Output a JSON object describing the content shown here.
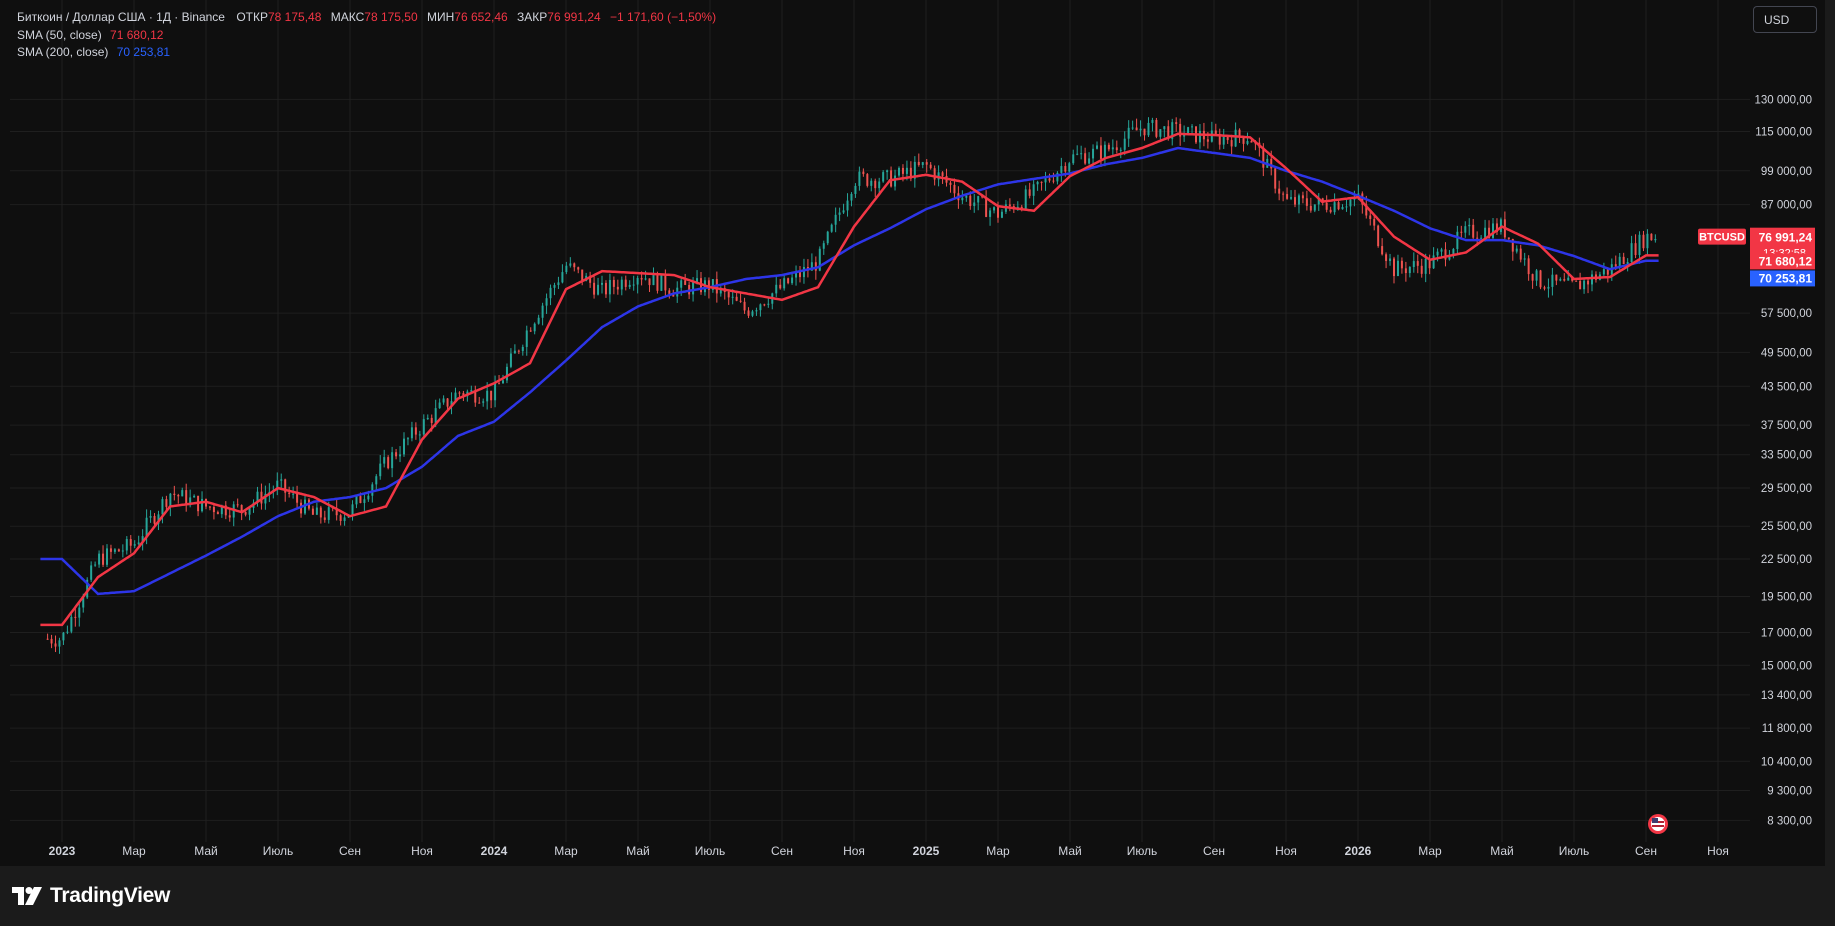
{
  "header": {
    "symbol": "Биткоин / Доллар США · 1Д · Binance",
    "open_label": "ОТКР",
    "open_value": "78 175,48",
    "high_label": "МАКС",
    "high_value": "78 175,50",
    "low_label": "МИН",
    "low_value": "76 652,46",
    "close_label": "ЗАКР",
    "close_value": "76 991,24",
    "change": "−1 171,60 (−1,50%)"
  },
  "indicators": [
    {
      "label": "SMA (50, close)",
      "value": "71 680,12",
      "color": "#f23645"
    },
    {
      "label": "SMA (200, close)",
      "value": "70 253,81",
      "color": "#2962ff"
    }
  ],
  "currency": "USD",
  "price_axis": {
    "ticks": [
      "130 000,00",
      "115 000,00",
      "99 000,00",
      "87 000,00",
      "57 500,00",
      "49 500,00",
      "43 500,00",
      "37 500,00",
      "33 500,00",
      "29 500,00",
      "25 500,00",
      "22 500,00",
      "19 500,00",
      "17 000,00",
      "15 000,00",
      "13 400,00",
      "11 800,00",
      "10 400,00",
      "9 300,00",
      "8 300,00"
    ],
    "symbol_tag": "BTCUSD",
    "price_tag": "76 991,24",
    "countdown": "13:32:58",
    "sma50_tag": "71 680,12",
    "sma200_tag": "70 253,81"
  },
  "time_axis": {
    "labels": [
      "2023",
      "Мар",
      "Май",
      "Июль",
      "Сен",
      "Ноя",
      "2024",
      "Мар",
      "Май",
      "Июль",
      "Сен",
      "Ноя",
      "2025",
      "Мар",
      "Май",
      "Июль",
      "Сен",
      "Ноя",
      "2026",
      "Мар",
      "Май",
      "Июль",
      "Сен",
      "Ноя"
    ],
    "bold": [
      "2023",
      "2024",
      "2025",
      "2026"
    ]
  },
  "colors": {
    "up": "#26a69a",
    "down": "#ef5350",
    "sma50": "#f23645",
    "sma200": "#2d35e8",
    "background": "#0f0f0f",
    "grid": "#1f1f1f",
    "price_tag": "#f23645",
    "sma200_tag": "#2962ff"
  },
  "brand": "TradingView",
  "chart_data": {
    "type": "line",
    "scale": "log",
    "title": "Биткоин / Доллар США · 1Д · Binance",
    "ylim": [
      8000,
      140000
    ],
    "grid": true,
    "x": [
      "2023-01",
      "2023-02",
      "2023-03",
      "2023-04",
      "2023-05",
      "2023-06",
      "2023-07",
      "2023-08",
      "2023-09",
      "2023-10",
      "2023-11",
      "2023-12",
      "2024-01",
      "2024-02",
      "2024-03",
      "2024-04",
      "2024-05",
      "2024-06",
      "2024-07",
      "2024-08",
      "2024-09",
      "2024-10",
      "2024-11",
      "2024-12",
      "2025-01",
      "2025-02",
      "2025-03",
      "2025-04",
      "2025-05",
      "2025-06",
      "2025-07",
      "2025-08",
      "2025-09",
      "2025-10",
      "2025-11",
      "2025-12",
      "2026-01",
      "2026-02",
      "2026-03",
      "2026-04",
      "2026-05",
      "2026-06",
      "2026-07",
      "2026-08",
      "2026-09"
    ],
    "series": [
      {
        "name": "BTCUSD",
        "values": [
          16600,
          22500,
          23800,
          29000,
          27500,
          27200,
          29800,
          26500,
          26900,
          32500,
          37500,
          42500,
          42200,
          55000,
          69000,
          62500,
          67000,
          63000,
          64000,
          58000,
          63500,
          70000,
          96000,
          96000,
          101000,
          90000,
          84000,
          91000,
          104000,
          107000,
          117000,
          115000,
          112000,
          113000,
          88000,
          87000,
          89000,
          68000,
          69500,
          78000,
          80000,
          65000,
          63500,
          68000,
          77000
        ]
      },
      {
        "name": "SMA (50, close)",
        "values": [
          17500,
          21000,
          23000,
          27500,
          28000,
          26900,
          29500,
          28500,
          26500,
          27500,
          35500,
          41500,
          44000,
          47500,
          63000,
          67500,
          67000,
          66500,
          63500,
          62000,
          60500,
          63500,
          80000,
          95500,
          97500,
          95000,
          86500,
          85000,
          97000,
          104000,
          108000,
          114000,
          113500,
          112500,
          100000,
          88000,
          89500,
          77000,
          70500,
          72500,
          80000,
          75000,
          65500,
          66000,
          71680
        ]
      },
      {
        "name": "SMA (200, close)",
        "values": [
          22500,
          19700,
          19900,
          21300,
          22800,
          24500,
          26500,
          28000,
          28500,
          29500,
          32000,
          36000,
          38000,
          42500,
          48000,
          54500,
          59000,
          62000,
          63500,
          65500,
          66500,
          68500,
          74500,
          79500,
          85500,
          90000,
          94000,
          96000,
          98000,
          101500,
          104000,
          108000,
          106000,
          104000,
          99000,
          95000,
          90000,
          85000,
          79500,
          76000,
          76000,
          74500,
          71500,
          68000,
          70254
        ]
      }
    ]
  }
}
